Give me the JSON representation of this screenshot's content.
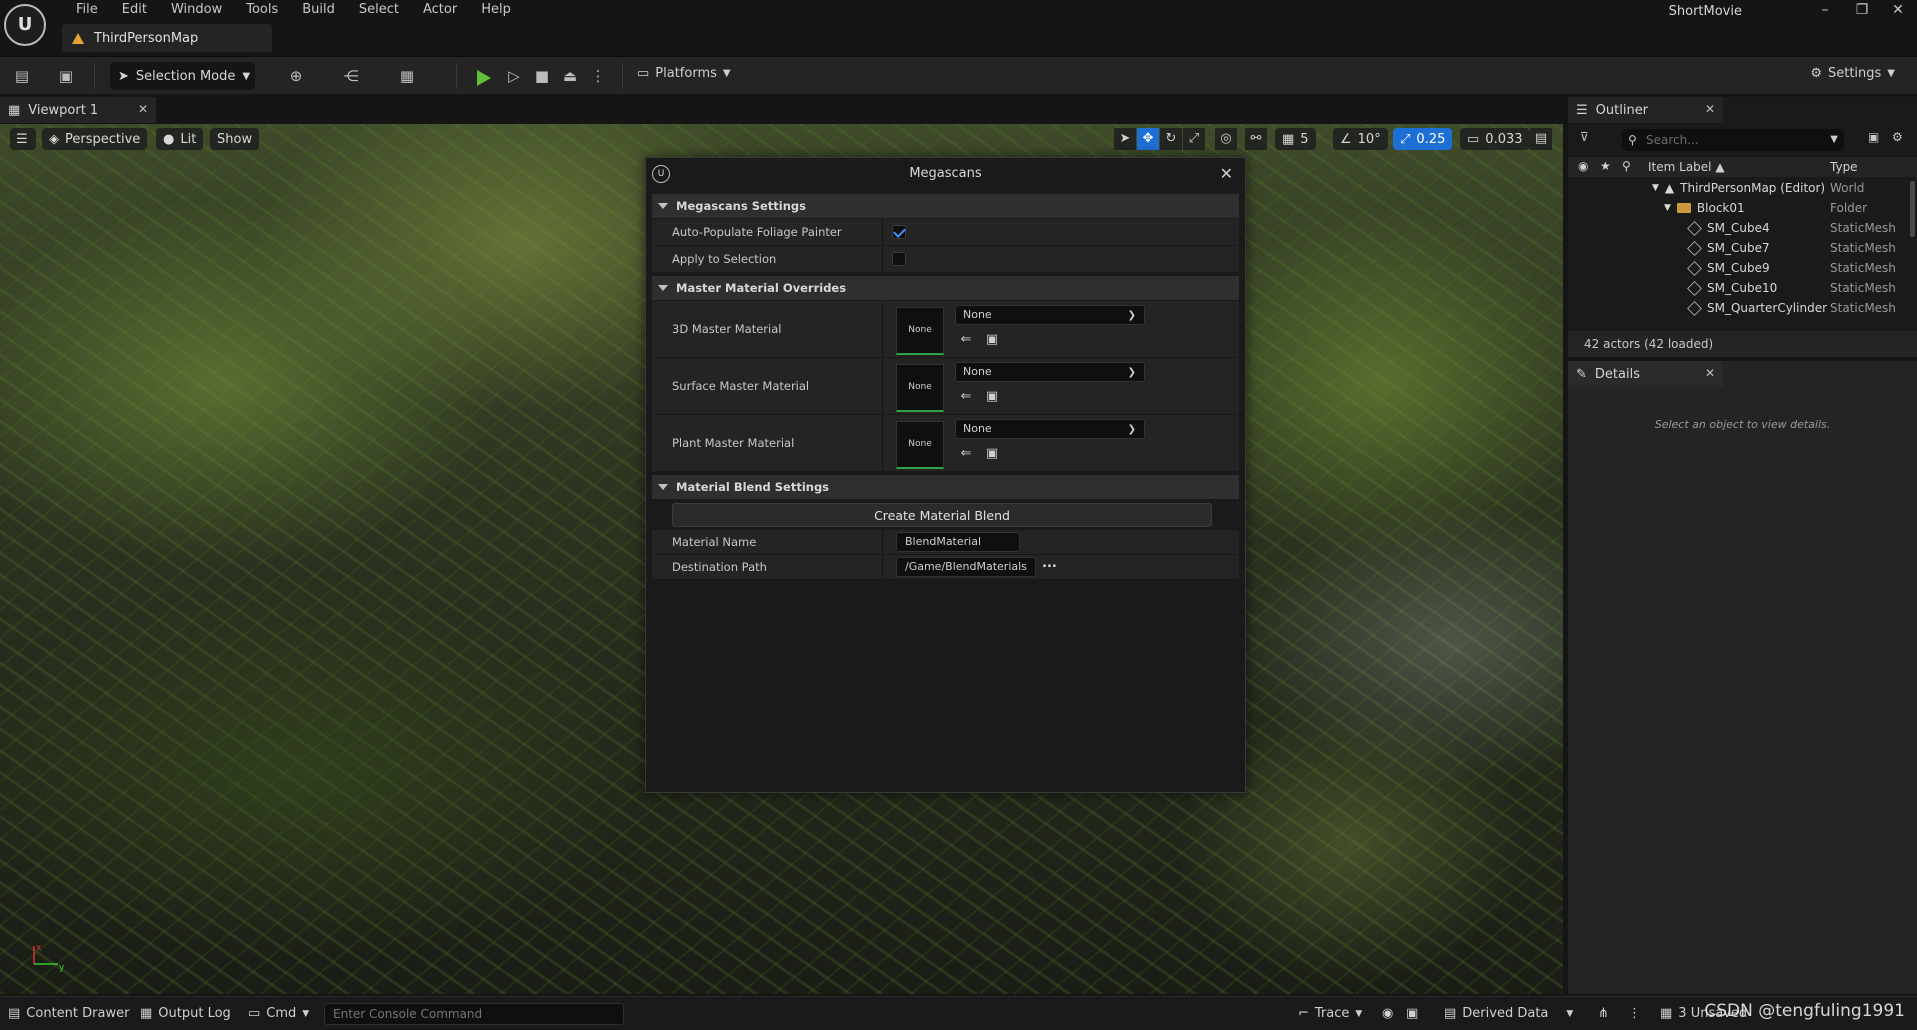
{
  "app": {
    "project_name": "ShortMovie",
    "logo_text": "U",
    "menu": [
      "File",
      "Edit",
      "Window",
      "Tools",
      "Build",
      "Select",
      "Actor",
      "Help"
    ],
    "document_tab": "ThirdPersonMap"
  },
  "toolbar": {
    "selection_mode": "Selection Mode",
    "platforms": "Platforms",
    "settings": "Settings"
  },
  "viewport": {
    "tab_label": "Viewport 1",
    "view_mode": "Perspective",
    "lighting": "Lit",
    "show": "Show",
    "grid_snap": "5",
    "rotation_snap": "10°",
    "scale_snap": "0.25",
    "camera_speed": "0.033"
  },
  "megascans": {
    "title": "Megascans",
    "logo_text": "U",
    "sections": {
      "settings": "Megascans Settings",
      "overrides": "Master Material Overrides",
      "blend": "Material Blend Settings"
    },
    "settings_rows": [
      {
        "label": "Auto-Populate Foliage Painter",
        "checked": true
      },
      {
        "label": "Apply to Selection",
        "checked": false
      }
    ],
    "materials": [
      {
        "label": "3D Master Material",
        "thumb": "None",
        "value": "None"
      },
      {
        "label": "Surface Master Material",
        "thumb": "None",
        "value": "None"
      },
      {
        "label": "Plant Master Material",
        "thumb": "None",
        "value": "None"
      }
    ],
    "create_blend_button": "Create Material Blend",
    "material_name_label": "Material Name",
    "material_name_value": "BlendMaterial",
    "destination_label": "Destination Path",
    "destination_value": "/Game/BlendMaterials",
    "browse": "..."
  },
  "outliner": {
    "tab_label": "Outliner",
    "search_placeholder": "Search...",
    "col_label": "Item Label ▲",
    "col_type": "Type",
    "items": [
      {
        "name": "ThirdPersonMap (Editor)",
        "type": "World",
        "level": 0
      },
      {
        "name": "Block01",
        "type": "Folder",
        "level": 1
      },
      {
        "name": "SM_Cube4",
        "type": "StaticMesh",
        "level": 2
      },
      {
        "name": "SM_Cube7",
        "type": "StaticMesh",
        "level": 2
      },
      {
        "name": "SM_Cube9",
        "type": "StaticMesh",
        "level": 2
      },
      {
        "name": "SM_Cube10",
        "type": "StaticMesh",
        "level": 2
      },
      {
        "name": "SM_QuarterCylinder",
        "type": "StaticMesh",
        "level": 2
      }
    ],
    "footer": "42 actors (42 loaded)"
  },
  "details": {
    "tab_label": "Details",
    "empty_text": "Select an object to view details."
  },
  "statusbar": {
    "content_drawer": "Content Drawer",
    "output_log": "Output Log",
    "cmd": "Cmd",
    "console_placeholder": "Enter Console Command",
    "trace": "Trace",
    "derived_data": "Derived Data",
    "unsaved": "3 Unsaved",
    "watermark": "CSDN @tengfuling1991"
  }
}
